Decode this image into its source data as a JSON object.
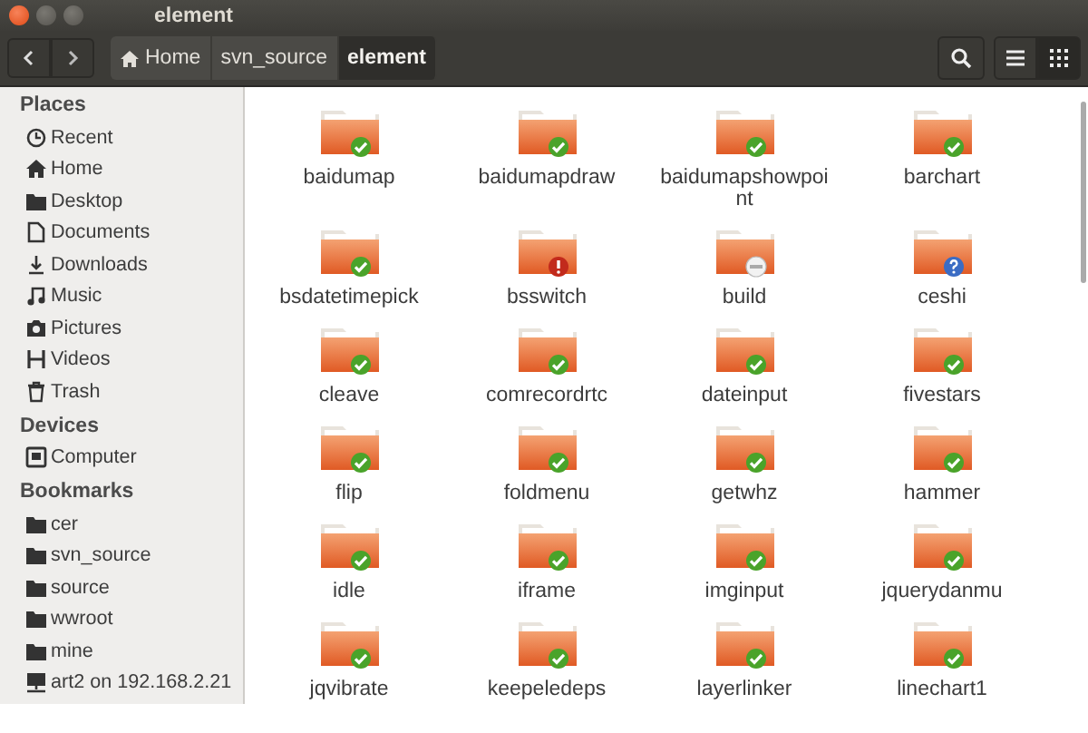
{
  "window": {
    "title": "element"
  },
  "toolbar": {
    "breadcrumbs": [
      {
        "label": "Home",
        "selected": false
      },
      {
        "label": "svn_source",
        "selected": false
      },
      {
        "label": "element",
        "selected": true
      }
    ],
    "views": [
      {
        "kind": "list",
        "selected": false
      },
      {
        "kind": "grid",
        "selected": true
      }
    ]
  },
  "sidebar": {
    "sections": [
      {
        "title": "Places",
        "items": [
          {
            "label": "Recent",
            "kind": "recent"
          },
          {
            "label": "Home",
            "kind": "home"
          },
          {
            "label": "Desktop",
            "kind": "folder"
          },
          {
            "label": "Documents",
            "kind": "document"
          },
          {
            "label": "Downloads",
            "kind": "download"
          },
          {
            "label": "Music",
            "kind": "music"
          },
          {
            "label": "Pictures",
            "kind": "camera"
          },
          {
            "label": "Videos",
            "kind": "video"
          },
          {
            "label": "Trash",
            "kind": "trash"
          }
        ]
      },
      {
        "title": "Devices",
        "items": [
          {
            "label": "Computer",
            "kind": "computer"
          }
        ]
      },
      {
        "title": "Bookmarks",
        "items": [
          {
            "label": "cer",
            "kind": "folder"
          },
          {
            "label": "svn_source",
            "kind": "folder"
          },
          {
            "label": "source",
            "kind": "folder"
          },
          {
            "label": "wwroot",
            "kind": "folder"
          },
          {
            "label": "mine",
            "kind": "folder"
          },
          {
            "label": "art2 on 192.168.2.21",
            "kind": "share"
          }
        ]
      }
    ]
  },
  "files": [
    {
      "name": "baidumap",
      "kind": "ok"
    },
    {
      "name": "baidumapdraw",
      "kind": "ok"
    },
    {
      "name": "baidumapshowpoint",
      "kind": "ok"
    },
    {
      "name": "barchart",
      "kind": "ok"
    },
    {
      "name": "bsdatetimepick",
      "kind": "ok"
    },
    {
      "name": "bsswitch",
      "kind": "error"
    },
    {
      "name": "build",
      "kind": "readonly"
    },
    {
      "name": "ceshi",
      "kind": "unknown"
    },
    {
      "name": "cleave",
      "kind": "ok"
    },
    {
      "name": "comrecordrtc",
      "kind": "ok"
    },
    {
      "name": "dateinput",
      "kind": "ok"
    },
    {
      "name": "fivestars",
      "kind": "ok"
    },
    {
      "name": "flip",
      "kind": "ok"
    },
    {
      "name": "foldmenu",
      "kind": "ok"
    },
    {
      "name": "getwhz",
      "kind": "ok"
    },
    {
      "name": "hammer",
      "kind": "ok"
    },
    {
      "name": "idle",
      "kind": "ok"
    },
    {
      "name": "iframe",
      "kind": "ok"
    },
    {
      "name": "imginput",
      "kind": "ok"
    },
    {
      "name": "jquerydanmu",
      "kind": "ok"
    },
    {
      "name": "jqvibrate",
      "kind": "ok"
    },
    {
      "name": "keepeledeps",
      "kind": "ok"
    },
    {
      "name": "layerlinker",
      "kind": "ok"
    },
    {
      "name": "linechart1",
      "kind": "ok"
    }
  ]
}
